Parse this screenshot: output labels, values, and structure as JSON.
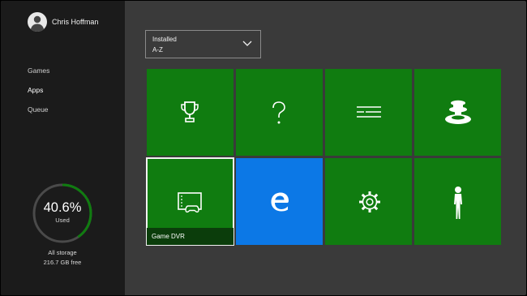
{
  "user": {
    "name": "Chris Hoffman",
    "avatar_icon": "person-silhouette-icon"
  },
  "nav": {
    "items": [
      "Games",
      "Apps",
      "Queue"
    ],
    "active": "Apps"
  },
  "storage": {
    "percent": "40.6%",
    "percent_value": 40.6,
    "used_label": "Used",
    "scope_label": "All storage",
    "free": "216.7 GB free",
    "ring_color": "#107c10"
  },
  "sort": {
    "label": "Installed",
    "value": "A-Z",
    "icon": "chevron-down-icon"
  },
  "tiles": [
    {
      "icon": "trophy-icon",
      "color": "#107c10"
    },
    {
      "icon": "help-question-icon",
      "color": "#107c10"
    },
    {
      "icon": "list-lines-icon",
      "color": "#107c10"
    },
    {
      "icon": "controller-stand-icon",
      "color": "#107c10"
    },
    {
      "icon": "game-dvr-icon",
      "caption": "Game DVR",
      "color": "#107c10",
      "selected": true
    },
    {
      "icon": "edge-browser-icon",
      "color": "#0c78e6"
    },
    {
      "icon": "settings-gear-icon",
      "color": "#107c10"
    },
    {
      "icon": "avatar-figure-icon",
      "color": "#107c10"
    }
  ],
  "colors": {
    "accent": "#107c10",
    "blue": "#0c78e6",
    "sidebar": "#1b1b1b",
    "background": "#3a3a3a"
  }
}
